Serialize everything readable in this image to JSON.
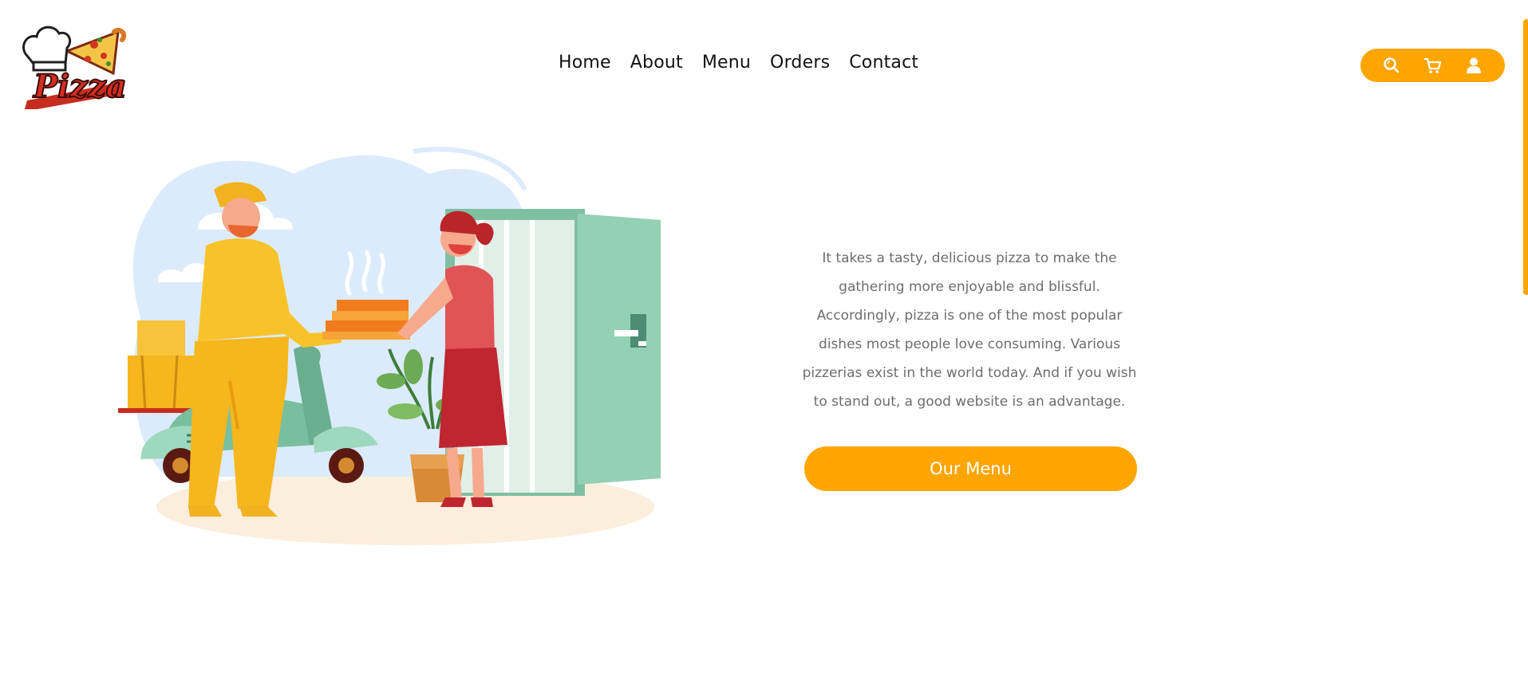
{
  "brand": {
    "logo_text": "Pizza",
    "logo_icon": "chef-hat-pizza-logo"
  },
  "nav": {
    "items": [
      {
        "label": "Home"
      },
      {
        "label": "About"
      },
      {
        "label": "Menu"
      },
      {
        "label": "Orders"
      },
      {
        "label": "Contact"
      }
    ]
  },
  "actions": {
    "icons": [
      "search-icon",
      "cart-icon",
      "user-icon"
    ]
  },
  "hero": {
    "illustration": "pizza-delivery-illustration",
    "description": "It takes a tasty, delicious pizza to make the gathering more enjoyable and blissful. Accordingly, pizza is one of the most popular dishes most people love consuming. Various pizzerias exist in the world today. And if you wish to stand out, a good website is an advantage.",
    "cta_label": "Our Menu"
  },
  "colors": {
    "accent": "#FFA500",
    "text_dark": "#111111",
    "text_muted": "#6D6D6D"
  }
}
